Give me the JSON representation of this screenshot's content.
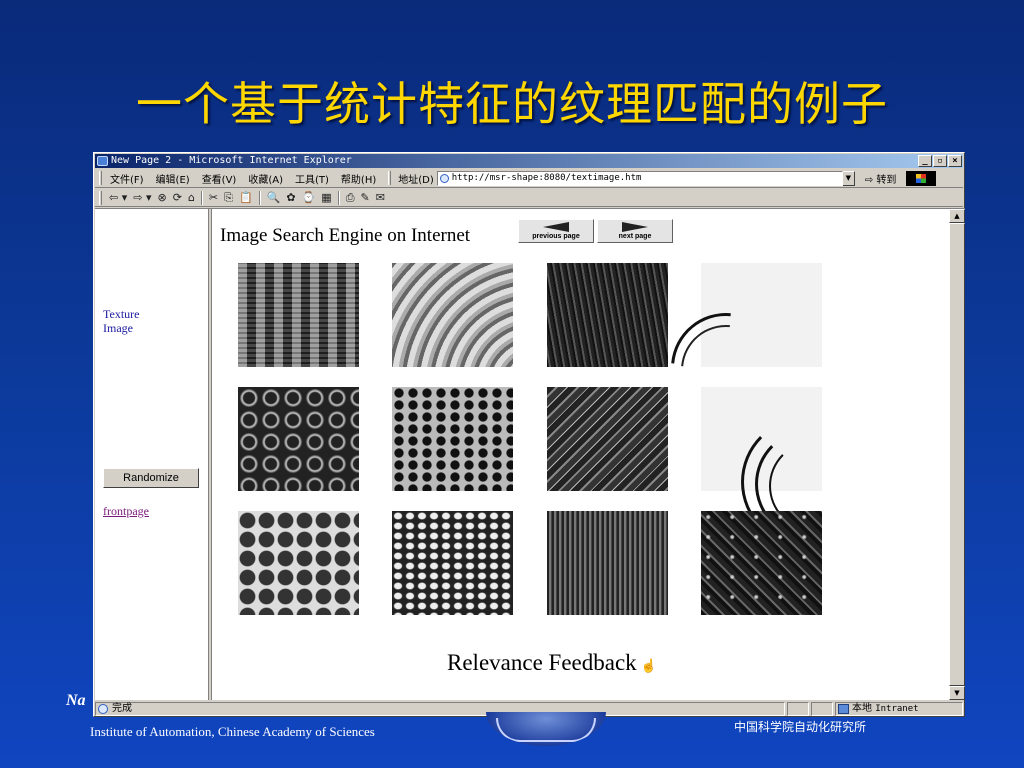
{
  "slide": {
    "title": "一个基于统计特征的纹理匹配的例子",
    "footer_left_italic": "Na",
    "footer_left": "Institute of Automation, Chinese Academy of Sciences",
    "footer_right": "中国科学院自动化研究所"
  },
  "window": {
    "title": "New Page 2 - Microsoft Internet Explorer",
    "controls": [
      "_",
      "▫",
      "×"
    ]
  },
  "menubar": {
    "items": [
      "文件(F)",
      "编辑(E)",
      "查看(V)",
      "收藏(A)",
      "工具(T)",
      "帮助(H)"
    ],
    "address_label": "地址(D)",
    "address_value": "http://msr-shape:8080/textimage.htm",
    "go_label": "转到"
  },
  "toolbar": {
    "back": "⇦ ▾",
    "forward": "⇨ ▾",
    "stop": "⊗",
    "refresh": "⟳",
    "home": "⌂",
    "cut": "✂",
    "copy": "⎘",
    "paste": "📋",
    "search": "🔍",
    "favorites": "✿",
    "history": "⌚",
    "media": "▦",
    "print": "⎙",
    "edit": "✎",
    "discuss": "✉"
  },
  "left_frame": {
    "texture_link_line1": "Texture",
    "texture_link_line2": "Image",
    "randomize_label": "Randomize",
    "frontpage_label": "frontpage"
  },
  "main_frame": {
    "title": "Image Search Engine on Internet",
    "previous_label": "previous page",
    "next_label": "next page",
    "feedback_label": "Relevance Feedback"
  },
  "textures": [
    {
      "name": "woven-texture"
    },
    {
      "name": "wood-grain-texture"
    },
    {
      "name": "bark-texture"
    },
    {
      "name": "white-curves-texture"
    },
    {
      "name": "foam-texture"
    },
    {
      "name": "hexagon-mesh-texture"
    },
    {
      "name": "marble-texture"
    },
    {
      "name": "arc-streaks-texture"
    },
    {
      "name": "circles-texture"
    },
    {
      "name": "honeycomb-texture"
    },
    {
      "name": "vertical-stripes-texture"
    },
    {
      "name": "crumpled-texture"
    }
  ],
  "statusbar": {
    "text": "完成",
    "zone_label": "本地",
    "zone_name": "Intranet"
  }
}
